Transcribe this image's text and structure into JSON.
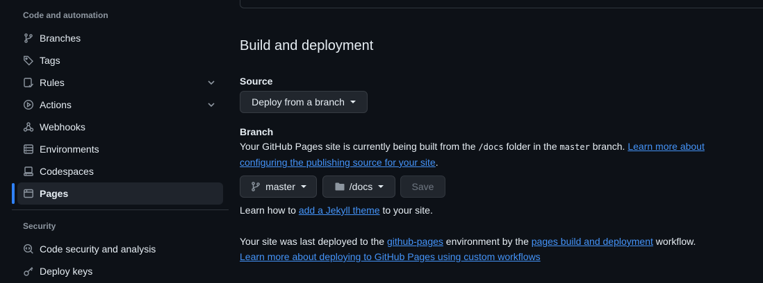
{
  "sidebar": {
    "code_heading": "Code and automation",
    "security_heading": "Security",
    "items": [
      {
        "label": "Branches",
        "icon": "git-branch-icon"
      },
      {
        "label": "Tags",
        "icon": "tag-icon"
      },
      {
        "label": "Rules",
        "icon": "rules-icon",
        "expandable": true
      },
      {
        "label": "Actions",
        "icon": "actions-play-icon",
        "expandable": true
      },
      {
        "label": "Webhooks",
        "icon": "webhook-icon"
      },
      {
        "label": "Environments",
        "icon": "server-icon"
      },
      {
        "label": "Codespaces",
        "icon": "codespaces-icon"
      },
      {
        "label": "Pages",
        "icon": "browser-icon",
        "active": true
      }
    ],
    "security_items": [
      {
        "label": "Code security and analysis",
        "icon": "codescan-icon"
      },
      {
        "label": "Deploy keys",
        "icon": "key-icon"
      }
    ]
  },
  "main": {
    "section_title": "Build and deployment",
    "source_label": "Source",
    "source_select": "Deploy from a branch",
    "branch_label": "Branch",
    "branch_desc_1": "Your GitHub Pages site is currently being built from the ",
    "branch_folder_code": "/docs",
    "branch_desc_2": " folder in the ",
    "branch_name_code": "master",
    "branch_desc_3": " branch. ",
    "branch_learn_link": "Learn more about configuring the publishing source for your site",
    "branch_desc_end": ".",
    "branch_button": "master",
    "folder_button": "/docs",
    "save_button": "Save",
    "jekyll_prefix": "Learn how to ",
    "jekyll_link": "add a Jekyll theme",
    "jekyll_suffix": " to your site.",
    "deploy_prefix": "Your site was last deployed to the ",
    "deploy_env_link": "github-pages",
    "deploy_mid": " environment by the ",
    "deploy_workflow_link": "pages build and deployment",
    "deploy_suffix": " workflow.",
    "custom_workflows_link": "Learn more about deploying to GitHub Pages using custom workflows"
  },
  "colors": {
    "background": "#0d1117",
    "accent": "#2f81f7",
    "link": "#4493f8",
    "muted": "#8d96a0"
  }
}
